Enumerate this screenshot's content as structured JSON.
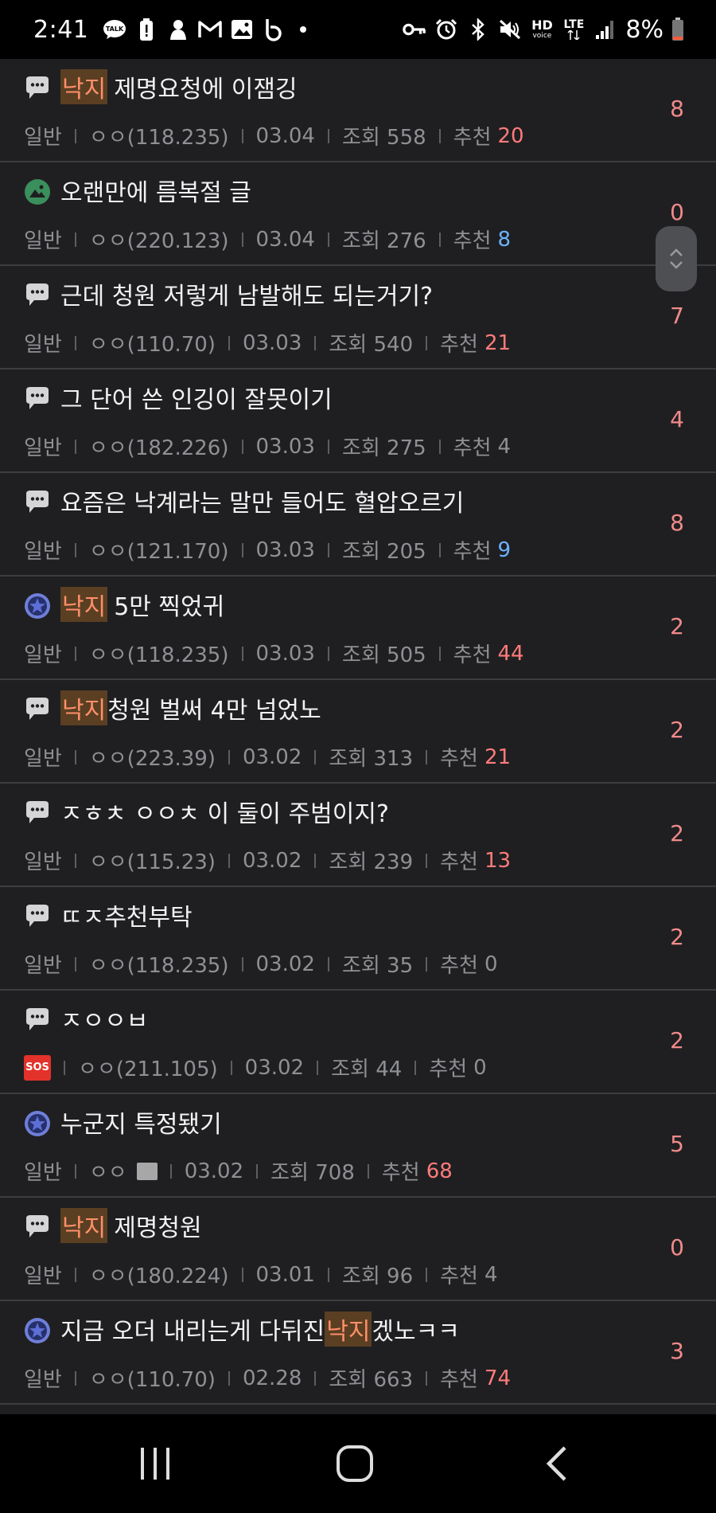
{
  "status_bar": {
    "time": "2:41",
    "battery": "8%",
    "left_icons": [
      "talk-icon",
      "battery-alert-icon",
      "app-icon",
      "gmail-icon",
      "gallery-icon",
      "b-app-icon"
    ],
    "right_icons": [
      "key-icon",
      "alarm-icon",
      "bluetooth-icon",
      "mute-icon",
      "hd-voice-icon",
      "lte-icon",
      "signal-icon",
      "battery-icon"
    ],
    "hd_label": "HD",
    "voice_label": "voice",
    "lte_label": "LTE"
  },
  "posts": [
    {
      "icon": "comment-bubble-icon",
      "keyword": "낙지",
      "title": " 제명요청에 이잼깅",
      "category": "일반",
      "author": "ㅇㅇ(118.235)",
      "date": "03.04",
      "views": "조회 558",
      "rec_label": "추천",
      "recommend": "20",
      "rec_style": "hot",
      "comments": "8"
    },
    {
      "icon": "image-post-icon",
      "keyword": "",
      "title": "오랜만에 름복절 글",
      "category": "일반",
      "author": "ㅇㅇ(220.123)",
      "date": "03.04",
      "views": "조회 276",
      "rec_label": "추천",
      "recommend": "8",
      "rec_style": "blue",
      "comments": "0"
    },
    {
      "icon": "comment-bubble-icon",
      "keyword": "",
      "title": "근데 청원 저렇게 남발해도 되는거기?",
      "category": "일반",
      "author": "ㅇㅇ(110.70)",
      "date": "03.03",
      "views": "조회 540",
      "rec_label": "추천",
      "recommend": "21",
      "rec_style": "hot",
      "comments": "7"
    },
    {
      "icon": "comment-bubble-icon",
      "keyword": "",
      "title": "그 단어 쓴 인깅이 잘못이기",
      "category": "일반",
      "author": "ㅇㅇ(182.226)",
      "date": "03.03",
      "views": "조회 275",
      "rec_label": "추천",
      "recommend": "4",
      "rec_style": "plain",
      "comments": "4"
    },
    {
      "icon": "comment-bubble-icon",
      "keyword": "",
      "title": "요즘은 낙계라는 말만 들어도 혈압오르기",
      "category": "일반",
      "author": "ㅇㅇ(121.170)",
      "date": "03.03",
      "views": "조회 205",
      "rec_label": "추천",
      "recommend": "9",
      "rec_style": "blue",
      "comments": "8"
    },
    {
      "icon": "star-badge-icon",
      "keyword": "낙지",
      "title": " 5만 찍었귀",
      "category": "일반",
      "author": "ㅇㅇ(118.235)",
      "date": "03.03",
      "views": "조회 505",
      "rec_label": "추천",
      "recommend": "44",
      "rec_style": "hot",
      "comments": "2"
    },
    {
      "icon": "comment-bubble-icon",
      "keyword": "낙지",
      "title": "청원 벌써 4만 넘었노",
      "category": "일반",
      "author": "ㅇㅇ(223.39)",
      "date": "03.02",
      "views": "조회 313",
      "rec_label": "추천",
      "recommend": "21",
      "rec_style": "hot",
      "comments": "2"
    },
    {
      "icon": "comment-bubble-icon",
      "keyword": "",
      "title": "ㅈㅎㅊ ㅇㅇㅊ 이 둘이 주범이지?",
      "category": "일반",
      "author": "ㅇㅇ(115.23)",
      "date": "03.02",
      "views": "조회 239",
      "rec_label": "추천",
      "recommend": "13",
      "rec_style": "hot",
      "comments": "2"
    },
    {
      "icon": "comment-bubble-icon",
      "keyword": "",
      "title": "ㄸㅈ추천부탁",
      "category": "일반",
      "author": "ㅇㅇ(118.235)",
      "date": "03.02",
      "views": "조회 35",
      "rec_label": "추천",
      "recommend": "0",
      "rec_style": "plain",
      "comments": "2"
    },
    {
      "icon": "comment-bubble-icon",
      "keyword": "",
      "title": "ㅈㅇㅇㅂ",
      "category": "SOS",
      "author": "ㅇㅇ(211.105)",
      "date": "03.02",
      "views": "조회 44",
      "rec_label": "추천",
      "recommend": "0",
      "rec_style": "plain",
      "comments": "2"
    },
    {
      "icon": "star-badge-icon",
      "keyword": "",
      "title": "누군지 특정됐기",
      "category": "일반",
      "author": "ㅇㅇ",
      "date": "03.02",
      "views": "조회 708",
      "rec_label": "추천",
      "recommend": "68",
      "rec_style": "hot",
      "comments": "5",
      "has_image": true
    },
    {
      "icon": "comment-bubble-icon",
      "keyword": "낙지",
      "title": " 제명청원",
      "category": "일반",
      "author": "ㅇㅇ(180.224)",
      "date": "03.01",
      "views": "조회 96",
      "rec_label": "추천",
      "recommend": "4",
      "rec_style": "plain",
      "comments": "0"
    },
    {
      "icon": "star-badge-icon",
      "keyword": "",
      "title": "지금 오더 내리는게 다뒤진 ",
      "keyword_after": "낙지",
      "title_after": "겠노ㅋㅋ",
      "category": "일반",
      "author": "ㅇㅇ(110.70)",
      "date": "02.28",
      "views": "조회 663",
      "rec_label": "추천",
      "recommend": "74",
      "rec_style": "hot",
      "comments": "3"
    }
  ],
  "colors": {
    "background": "#1f1f21",
    "divider": "#3c3d41",
    "keyword_bg": "#5a3f22",
    "keyword_text": "#ff8f6a",
    "recommend_hot": "#ff7b7b",
    "recommend_blue": "#6db2ff",
    "comment_count": "#f08a8a"
  },
  "nav_bar": {
    "buttons": [
      "recent-apps-icon",
      "home-icon",
      "back-icon"
    ]
  }
}
